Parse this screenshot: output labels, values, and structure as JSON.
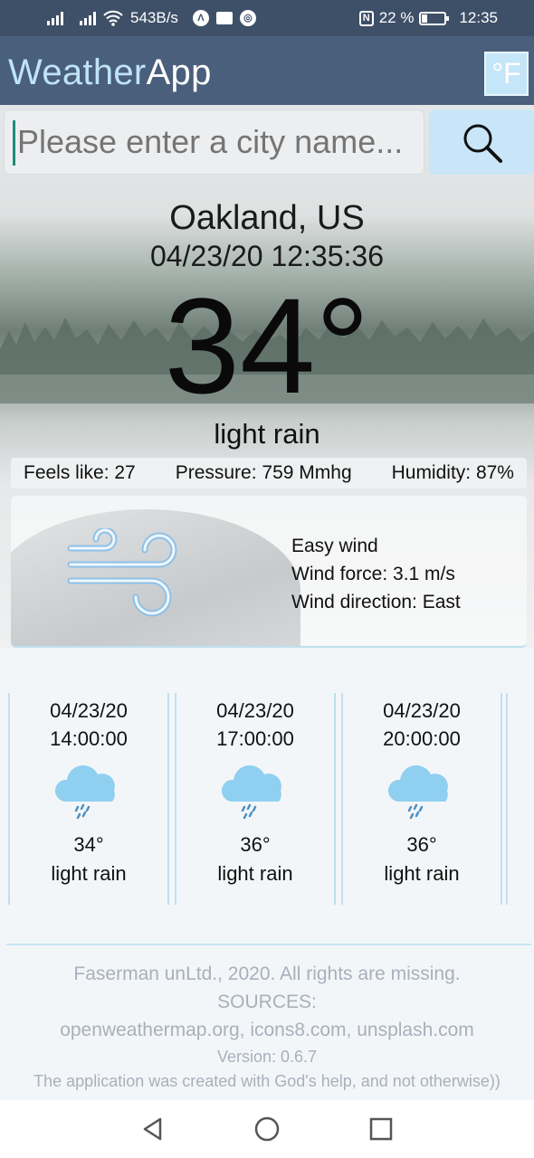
{
  "status_bar": {
    "net_speed": "543B/s",
    "battery": "22 %",
    "time": "12:35",
    "icons": [
      "signal-icon",
      "signal-icon",
      "wifi-icon",
      "app-icon",
      "mail-icon",
      "chrome-icon",
      "nfc-icon",
      "battery-icon"
    ]
  },
  "app_bar": {
    "title_part1": "Weather",
    "title_part2": "App",
    "unit_toggle": "°F",
    "colors": {
      "bar": "#4a5f7c",
      "accent": "#bfe3f7",
      "button": "#c5e6f8"
    }
  },
  "search": {
    "placeholder": "Please enter a city name...",
    "value": "",
    "button_icon": "search-icon"
  },
  "current": {
    "city": "Oakland, US",
    "datetime": "04/23/20 12:35:36",
    "temperature": "34°",
    "condition": "light rain",
    "feels_like": "Feels like: 27",
    "pressure": "Pressure: 759 Mmhg",
    "humidity": "Humidity: 87%"
  },
  "wind": {
    "icon": "wind-icon",
    "description": "Easy wind",
    "force": "Wind force: 3.1 m/s",
    "direction": "Wind direction: East"
  },
  "forecast": [
    {
      "date": "04/23/20",
      "time": "14:00:00",
      "icon": "rain-cloud-icon",
      "temp": "34°",
      "condition": "light rain"
    },
    {
      "date": "04/23/20",
      "time": "17:00:00",
      "icon": "rain-cloud-icon",
      "temp": "36°",
      "condition": "light rain"
    },
    {
      "date": "04/23/20",
      "time": "20:00:00",
      "icon": "rain-cloud-icon",
      "temp": "36°",
      "condition": "light rain"
    }
  ],
  "footer": {
    "copyright": "Faserman unLtd., 2020. All rights are missing.",
    "sources_label": "SOURCES:",
    "sources": "openweathermap.org, icons8.com, unsplash.com",
    "version": "Version: 0.6.7",
    "note": "The application was created with God's help, and not otherwise))"
  },
  "nav_bar": {
    "icons": [
      "back-icon",
      "home-icon",
      "recents-icon"
    ]
  }
}
